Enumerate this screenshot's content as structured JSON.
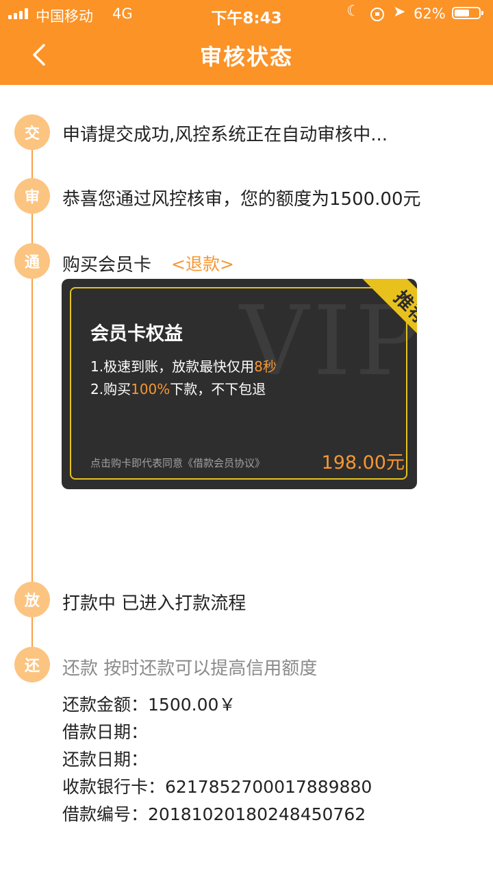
{
  "status_bar": {
    "carrier": "中国移动",
    "network": "4G",
    "time": "下午8:43",
    "battery": "62%",
    "battery_level": 0.62
  },
  "nav": {
    "title": "审核状态"
  },
  "steps": [
    {
      "badge": "交",
      "text": "申请提交成功,风控系统正在自动审核中..."
    },
    {
      "badge": "审",
      "text": "恭喜您通过风控核审，您的额度为1500.00元"
    },
    {
      "badge": "通",
      "text": "购买会员卡",
      "link": "<退款>"
    },
    {
      "badge": "放",
      "text": "打款中 已进入打款流程"
    },
    {
      "badge": "还",
      "text": "还款 按时还款可以提高信用额度"
    }
  ],
  "member_card": {
    "watermark": "VIP",
    "ribbon": "推荐",
    "title": "会员卡权益",
    "benefit1_prefix": "1.极速到账，放款最快仅用",
    "benefit1_highlight": "8秒",
    "benefit2_prefix": "2.购买",
    "benefit2_highlight": "100%",
    "benefit2_suffix": "下款，不下包退",
    "agreement": "点击购卡即代表同意《借款会员协议》",
    "price": "198.00元"
  },
  "repayment": {
    "amount_label": "还款金额：",
    "amount_value": "1500.00￥",
    "loan_date_label": "借款日期：",
    "loan_date_value": "",
    "repay_date_label": "还款日期：",
    "repay_date_value": "",
    "bank_card_label": "收款银行卡：",
    "bank_card_value": "6217852700017889880",
    "loan_number_label": "借款编号：",
    "loan_number_value": "201810201802484507​62"
  },
  "colors": {
    "header": "#fb9327",
    "accent": "#f79733",
    "badge": "#fcc481",
    "card_bg": "#2e2e2e",
    "card_gold": "#e6c21f"
  }
}
